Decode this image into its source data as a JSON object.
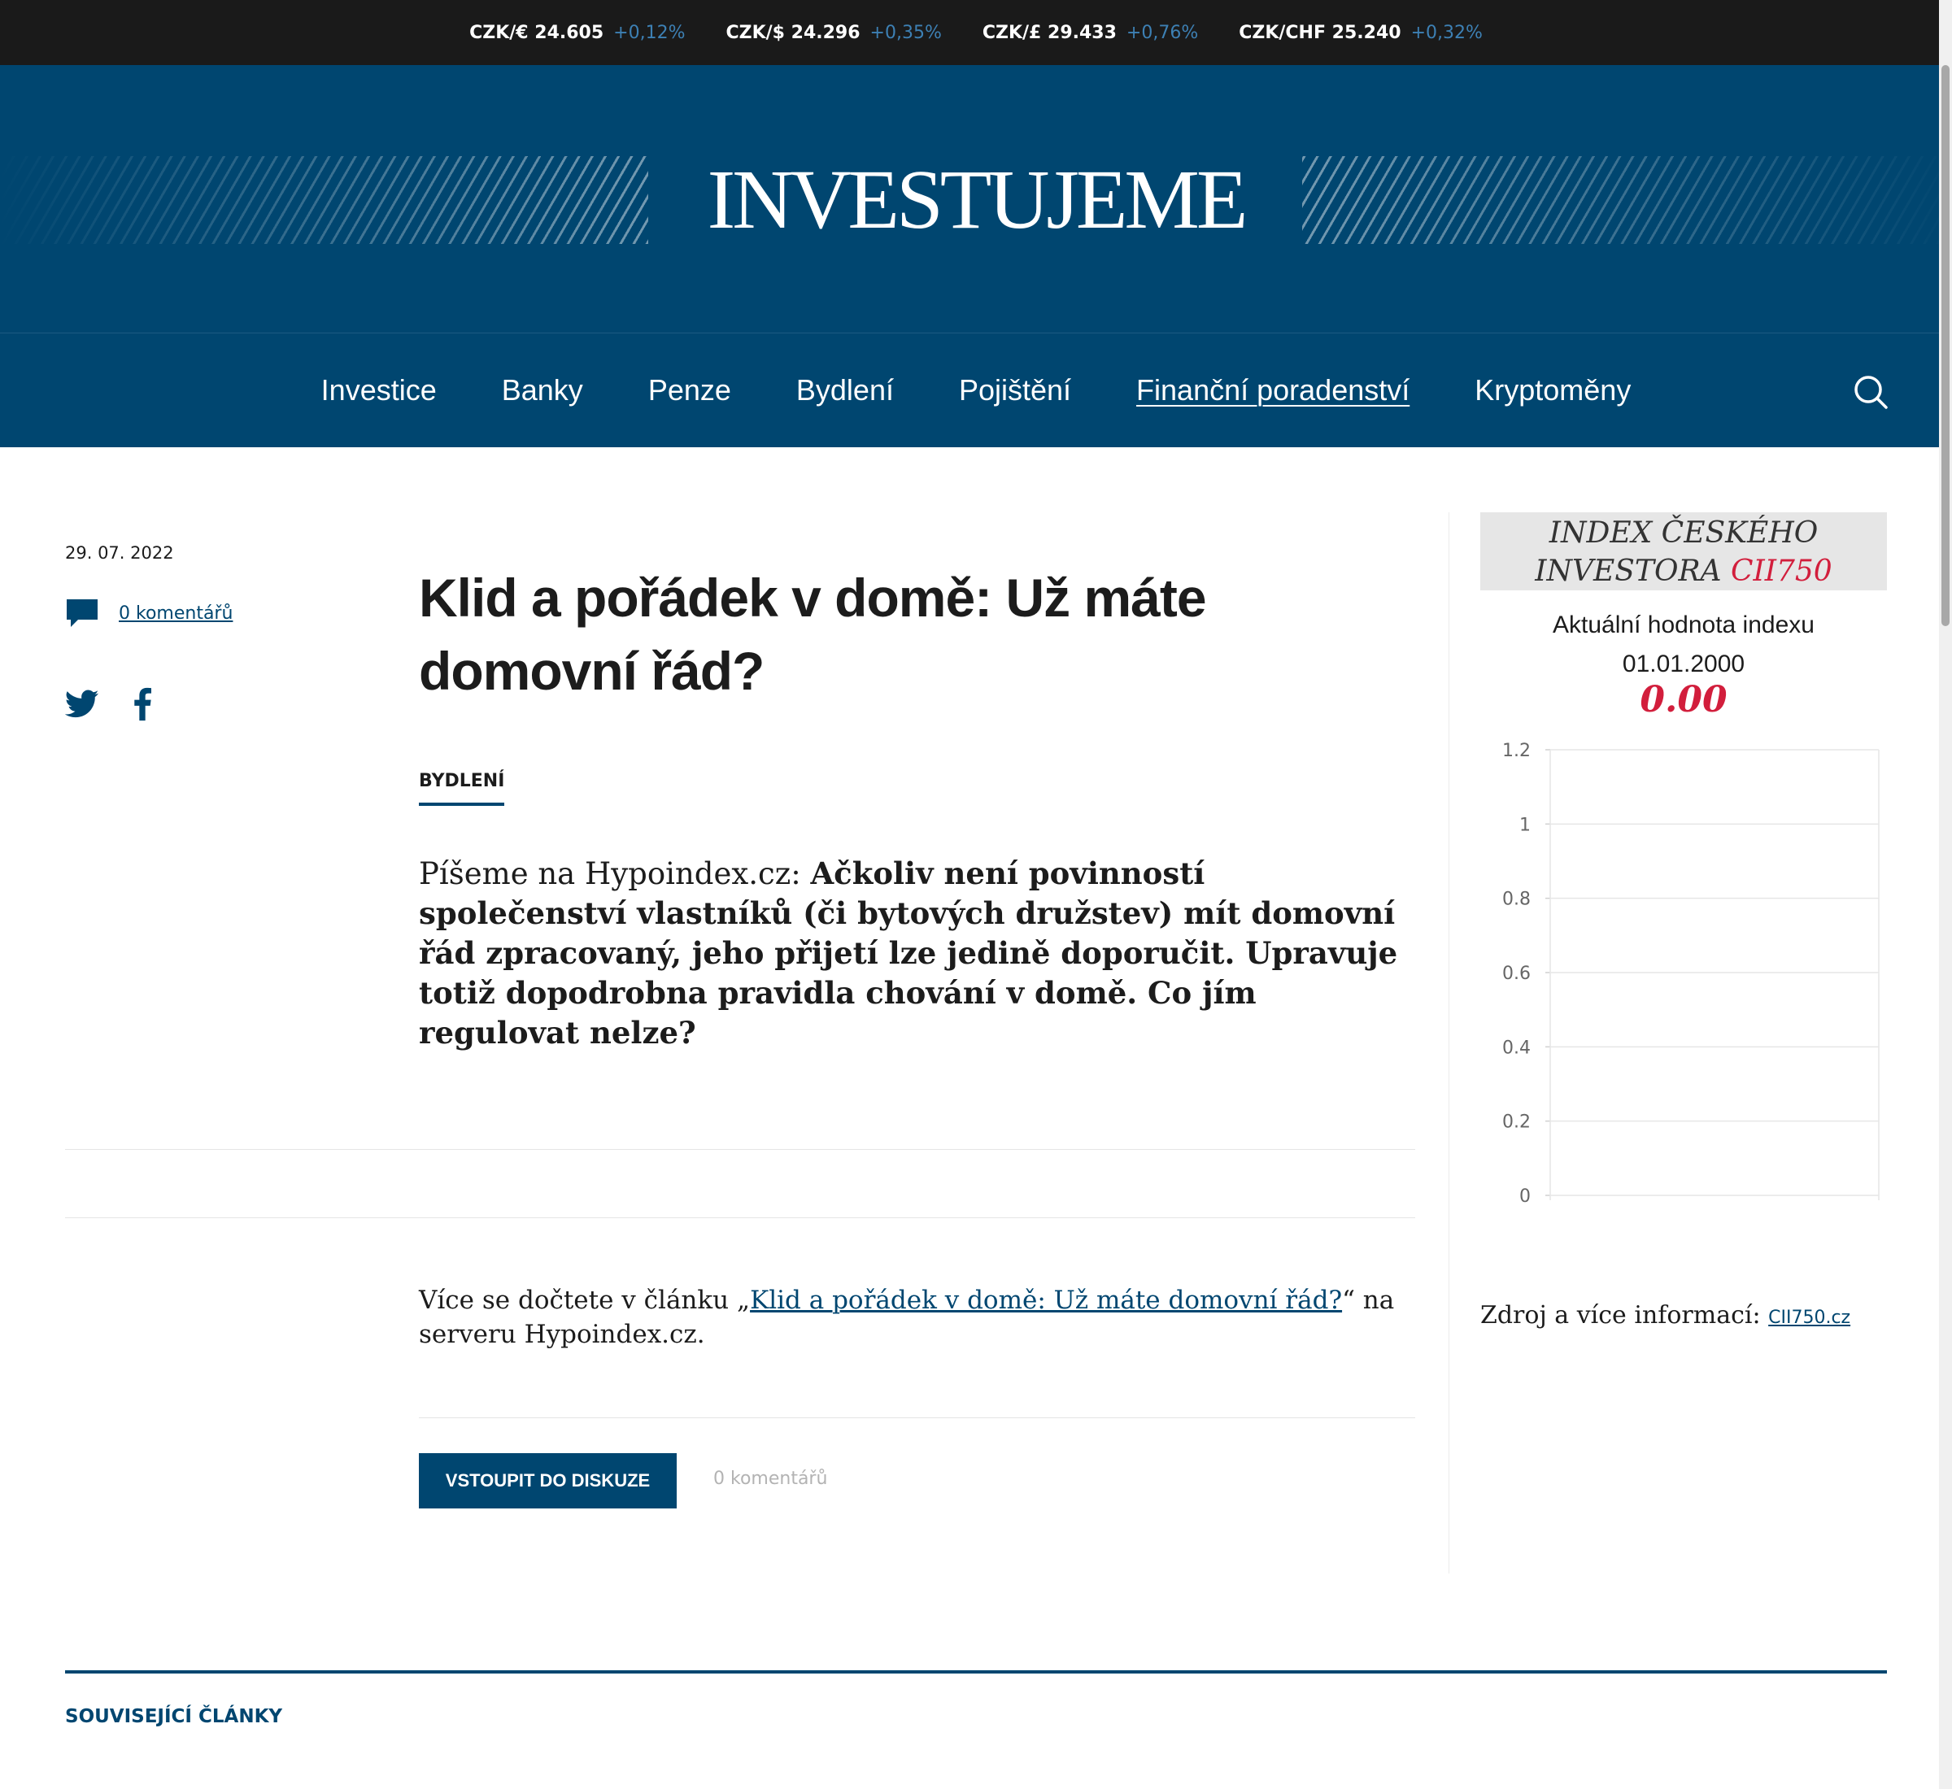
{
  "ticker": [
    {
      "label": "CZK/€ 24.605",
      "change": "+0,12%"
    },
    {
      "label": "CZK/$ 24.296",
      "change": "+0,35%"
    },
    {
      "label": "CZK/£ 29.433",
      "change": "+0,76%"
    },
    {
      "label": "CZK/CHF 25.240",
      "change": "+0,32%"
    }
  ],
  "header": {
    "logo": "INVESTUJEME"
  },
  "nav": {
    "items": [
      "Investice",
      "Banky",
      "Penze",
      "Bydlení",
      "Pojištění",
      "Finanční poradenství",
      "Kryptoměny"
    ],
    "active": "Finanční poradenství",
    "search_icon": "search-icon"
  },
  "meta": {
    "date": "29. 07. 2022",
    "comments_link": "0 komentářů",
    "comment_icon": "comment-icon",
    "social_icons": [
      "twitter-icon",
      "facebook-icon"
    ]
  },
  "article": {
    "title": "Klid a pořádek v domě: Už máte domovní řád?",
    "category": "BYDLENÍ",
    "lead_prefix": "Píšeme na Hypoindex.cz: ",
    "lead_bold": "Ačkoliv není povinností společenství vlastníků (či bytových družstev) mít domovní řád zpracovaný, jeho přijetí lze jedině doporučit. Upravuje totiž dopodrobna pravidla chování v domě. Co jím regulovat nelze?",
    "more_prefix": "Více se dočtete v článku „",
    "more_link": "Klid a pořádek v domě: Už máte domovní řád?",
    "more_suffix": "“ na serveru Hypoindex.cz.",
    "discuss_button": "VSTOUPIT DO DISKUZE",
    "discuss_count": "0 komentářů"
  },
  "widget": {
    "title_line1": "INDEX ČESKÉHO",
    "title_line2": "INVESTORA",
    "title_code": "CII750",
    "subtitle": "Aktuální hodnota indexu",
    "date": "01.01.2000",
    "value": "0.00",
    "source_label": "Zdroj a více informací: ",
    "source_link": "CII750.cz",
    "accent_color": "#d21e3c"
  },
  "chart_data": {
    "type": "line",
    "series": [],
    "ylim": [
      0,
      1.2
    ],
    "yticks": [
      "0",
      "0.2",
      "0.4",
      "0.6",
      "0.8",
      "1",
      "1.2"
    ],
    "grid": true
  },
  "related": {
    "title": "SOUVISEJÍCÍ ČLÁNKY"
  },
  "colors": {
    "brand": "#004670",
    "ticker_bg": "#1a1a1a",
    "ticker_change": "#3d80b4"
  }
}
